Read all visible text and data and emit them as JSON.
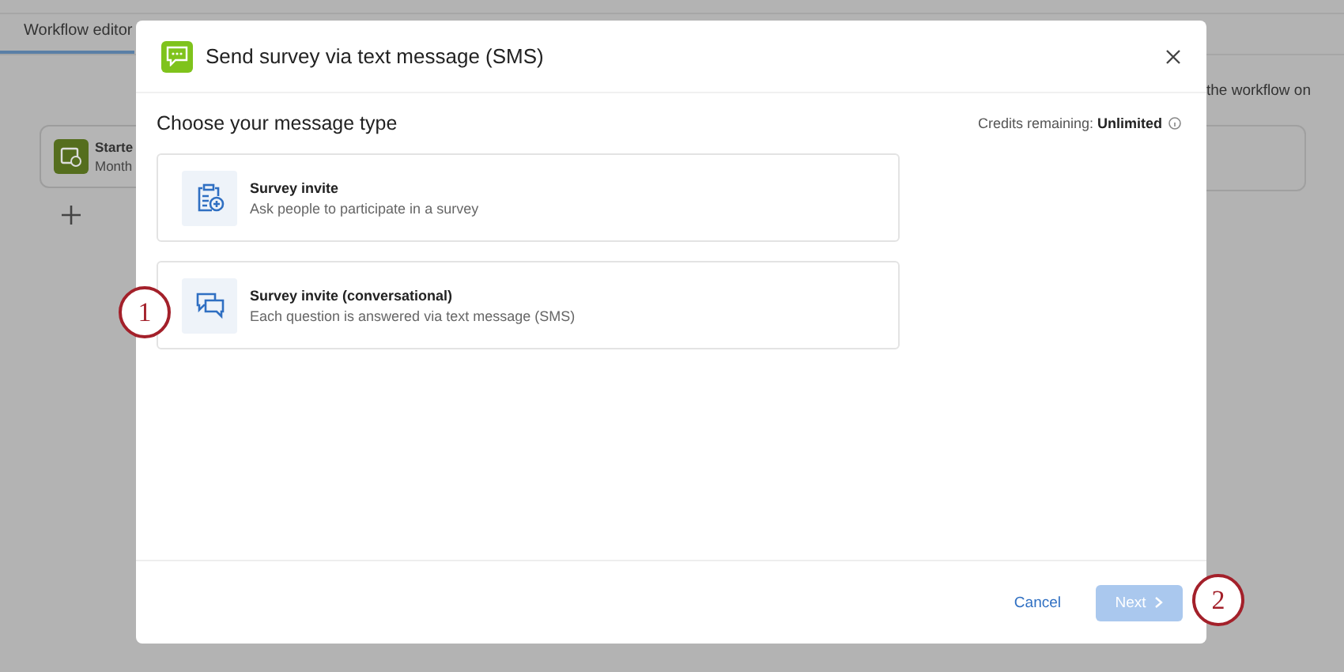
{
  "page": {
    "tab": "Workflow editor",
    "node": {
      "title": "Starte",
      "subtitle": "Month"
    },
    "side_text": "the workflow on"
  },
  "dialog": {
    "title": "Send survey via text message (SMS)",
    "heading": "Choose your message type",
    "credits_label": "Credits remaining:",
    "credits_value": "Unlimited",
    "options": [
      {
        "title": "Survey invite",
        "description": "Ask people to participate in a survey",
        "kind": "invite",
        "selected": false
      },
      {
        "title": "Survey invite (conversational)",
        "description": "Each question is answered via text message (SMS)",
        "kind": "conversation",
        "selected": false
      }
    ],
    "cancel": "Cancel",
    "next": {
      "label": "Next",
      "disabled": true
    }
  },
  "annotations": [
    "1",
    "2"
  ]
}
